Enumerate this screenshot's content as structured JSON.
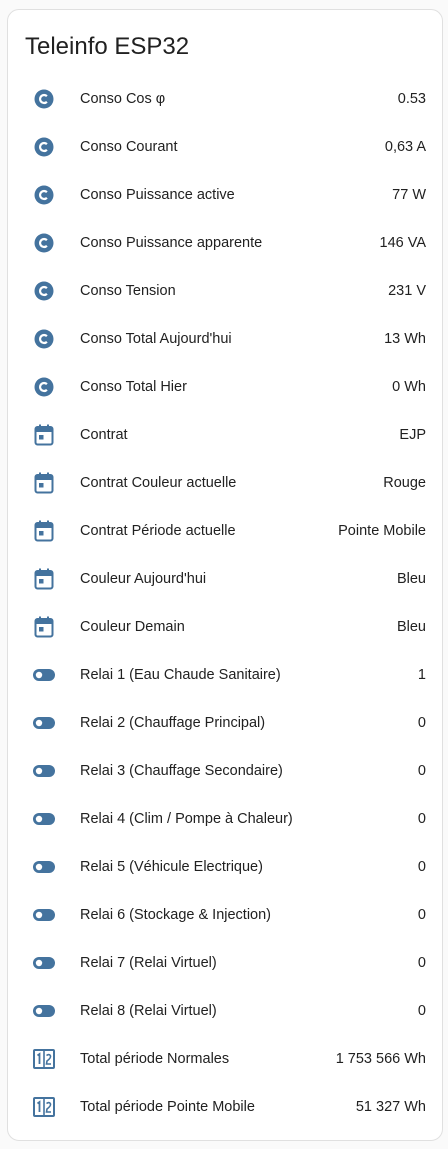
{
  "card": {
    "title": "Teleinfo ESP32"
  },
  "colors": {
    "icon": "#44739e",
    "text": "#212121",
    "card_background": "#ffffff",
    "page_background": "#fafafa"
  },
  "entities": [
    {
      "name": "Conso Cos φ",
      "value": "0.53",
      "icon": "alpha-c-circle-icon"
    },
    {
      "name": "Conso Courant",
      "value": "0,63 A",
      "icon": "alpha-c-circle-icon"
    },
    {
      "name": "Conso Puissance active",
      "value": "77 W",
      "icon": "alpha-c-circle-icon"
    },
    {
      "name": "Conso Puissance apparente",
      "value": "146 VA",
      "icon": "alpha-c-circle-icon"
    },
    {
      "name": "Conso Tension",
      "value": "231 V",
      "icon": "alpha-c-circle-icon"
    },
    {
      "name": "Conso Total Aujourd'hui",
      "value": "13 Wh",
      "icon": "alpha-c-circle-icon"
    },
    {
      "name": "Conso Total Hier",
      "value": "0 Wh",
      "icon": "alpha-c-circle-icon"
    },
    {
      "name": "Contrat",
      "value": "EJP",
      "icon": "calendar-icon"
    },
    {
      "name": "Contrat Couleur actuelle",
      "value": "Rouge",
      "icon": "calendar-icon"
    },
    {
      "name": "Contrat Période actuelle",
      "value": "Pointe Mobile",
      "icon": "calendar-icon"
    },
    {
      "name": "Couleur Aujourd'hui",
      "value": "Bleu",
      "icon": "calendar-icon"
    },
    {
      "name": "Couleur Demain",
      "value": "Bleu",
      "icon": "calendar-icon"
    },
    {
      "name": "Relai 1 (Eau Chaude Sanitaire)",
      "value": "1",
      "icon": "toggle-switch-icon"
    },
    {
      "name": "Relai 2 (Chauffage Principal)",
      "value": "0",
      "icon": "toggle-switch-icon"
    },
    {
      "name": "Relai 3 (Chauffage Secondaire)",
      "value": "0",
      "icon": "toggle-switch-icon"
    },
    {
      "name": "Relai 4 (Clim / Pompe à Chaleur)",
      "value": "0",
      "icon": "toggle-switch-icon"
    },
    {
      "name": "Relai 5 (Véhicule Electrique)",
      "value": "0",
      "icon": "toggle-switch-icon"
    },
    {
      "name": "Relai 6 (Stockage & Injection)",
      "value": "0",
      "icon": "toggle-switch-icon"
    },
    {
      "name": "Relai 7 (Relai Virtuel)",
      "value": "0",
      "icon": "toggle-switch-icon"
    },
    {
      "name": "Relai 8 (Relai Virtuel)",
      "value": "0",
      "icon": "toggle-switch-icon"
    },
    {
      "name": "Total période Normales",
      "value": "1 753 566 Wh",
      "icon": "counter-icon"
    },
    {
      "name": "Total période Pointe Mobile",
      "value": "51 327 Wh",
      "icon": "counter-icon"
    }
  ]
}
